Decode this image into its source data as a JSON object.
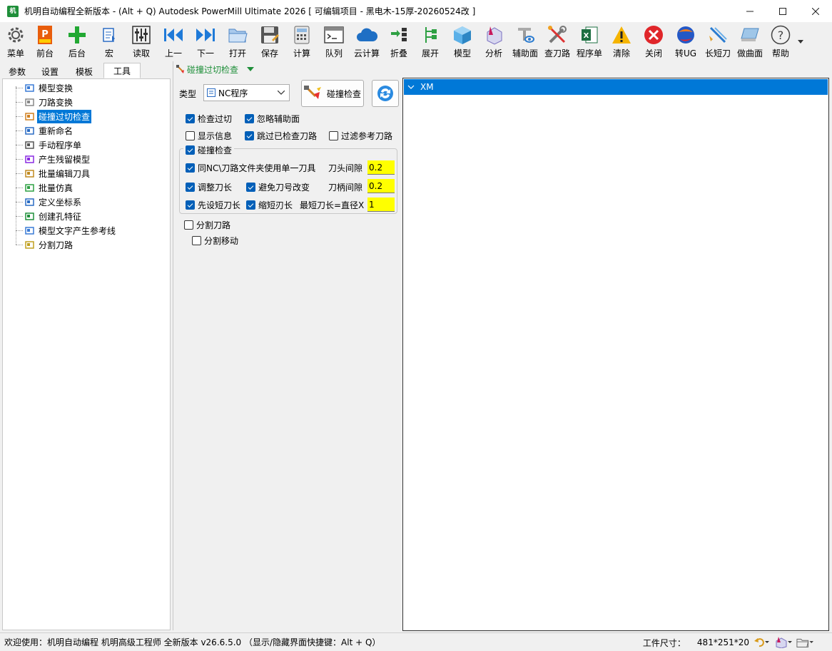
{
  "window": {
    "title": "机明自动编程全新版本 - (Alt + Q) Autodesk PowerMill Ultimate 2026    [ 可编辑项目 - 黑电木-15厚-20260524改 ]",
    "icon_text": "机"
  },
  "toolbar": [
    {
      "label": "菜单",
      "icon": "gear-icon"
    },
    {
      "label": "前台",
      "icon": "powermill-icon"
    },
    {
      "label": "后台",
      "icon": "plus-icon"
    },
    {
      "label": "宏",
      "icon": "macro-icon"
    },
    {
      "label": "读取",
      "icon": "sliders-icon"
    },
    {
      "label": "上一",
      "icon": "skip-back-icon"
    },
    {
      "label": "下一",
      "icon": "skip-forward-icon"
    },
    {
      "label": "打开",
      "icon": "folder-icon"
    },
    {
      "label": "保存",
      "icon": "save-icon"
    },
    {
      "label": "计算",
      "icon": "calculator-icon"
    },
    {
      "label": "队列",
      "icon": "terminal-icon"
    },
    {
      "label": "云计算",
      "icon": "cloud-icon"
    },
    {
      "label": "折叠",
      "icon": "collapse-icon"
    },
    {
      "label": "展开",
      "icon": "expand-tree-icon"
    },
    {
      "label": "模型",
      "icon": "cube-icon"
    },
    {
      "label": "分析",
      "icon": "analysis-icon"
    },
    {
      "label": "辅助面",
      "icon": "aux-surface-icon"
    },
    {
      "label": "查刀路",
      "icon": "tools-icon"
    },
    {
      "label": "程序单",
      "icon": "excel-icon"
    },
    {
      "label": "清除",
      "icon": "warning-icon"
    },
    {
      "label": "关闭",
      "icon": "close-circle-icon"
    },
    {
      "label": "转UG",
      "icon": "ug-icon"
    },
    {
      "label": "长短刀",
      "icon": "tool-length-icon"
    },
    {
      "label": "做曲面",
      "icon": "surface-icon"
    },
    {
      "label": "帮助",
      "icon": "help-icon"
    }
  ],
  "left_tabs": [
    {
      "label": "参数",
      "active": false
    },
    {
      "label": "设置",
      "active": false
    },
    {
      "label": "模板",
      "active": false
    },
    {
      "label": "工具",
      "active": true
    }
  ],
  "tree_items": [
    {
      "label": "模型变换",
      "icon": "model-transform-icon"
    },
    {
      "label": "刀路变换",
      "icon": "toolpath-transform-icon"
    },
    {
      "label": "碰撞过切检查",
      "icon": "collision-check-icon",
      "selected": true
    },
    {
      "label": "重新命名",
      "icon": "rename-icon"
    },
    {
      "label": "手动程序单",
      "icon": "manual-sheet-icon"
    },
    {
      "label": "产生残留模型",
      "icon": "stock-model-icon"
    },
    {
      "label": "批量编辑刀具",
      "icon": "batch-tool-icon"
    },
    {
      "label": "批量仿真",
      "icon": "batch-sim-icon"
    },
    {
      "label": "定义坐标系",
      "icon": "workplane-icon"
    },
    {
      "label": "创建孔特征",
      "icon": "hole-feature-icon"
    },
    {
      "label": "模型文字产生参考线",
      "icon": "text-pattern-icon"
    },
    {
      "label": "分割刀路",
      "icon": "split-toolpath-icon"
    }
  ],
  "collision": {
    "header": "碰撞过切检查",
    "type_label": "类型",
    "type_value": "NC程序",
    "check_button": "碰撞检查",
    "check_gouge": {
      "label": "检查过切",
      "checked": true
    },
    "ignore_aux": {
      "label": "忽略辅助面",
      "checked": true
    },
    "show_info": {
      "label": "显示信息",
      "checked": false
    },
    "skip_checked": {
      "label": "跳过已检查刀路",
      "checked": true
    },
    "filter_ref": {
      "label": "过滤参考刀路",
      "checked": false
    },
    "group_title": {
      "label": "碰撞检查",
      "checked": true
    },
    "same_nc": {
      "label": "同NC\\刀路文件夹使用单一刀具",
      "checked": true
    },
    "adjust_length": {
      "label": "调整刀长",
      "checked": true
    },
    "avoid_tool_num": {
      "label": "避免刀号改变",
      "checked": true
    },
    "preset_short": {
      "label": "先设短刀长",
      "checked": true
    },
    "shorten": {
      "label": "缩短刃长",
      "checked": true
    },
    "head_clearance_label": "刀头间隙",
    "head_clearance_value": "0.2",
    "holder_clearance_label": "刀柄间隙",
    "holder_clearance_value": "0.2",
    "min_length_label": "最短刀长=直径X",
    "min_length_value": "1",
    "split_toolpath": {
      "label": "分割刀路",
      "checked": false
    },
    "split_move": {
      "label": "分割移动",
      "checked": false
    }
  },
  "right_list": [
    {
      "label": "XM",
      "selected": true
    }
  ],
  "status": {
    "welcome": "欢迎使用：机明自动编程 机明高级工程师 全新版本 v26.6.5.0  （显示/隐藏界面快捷键：Alt + Q）",
    "work_size_label": "工件尺寸：",
    "work_size_value": "481*251*20"
  },
  "colors": {
    "accent": "#0078d7",
    "highlight_input": "#ffff00",
    "green_header": "#1f8f3a"
  }
}
